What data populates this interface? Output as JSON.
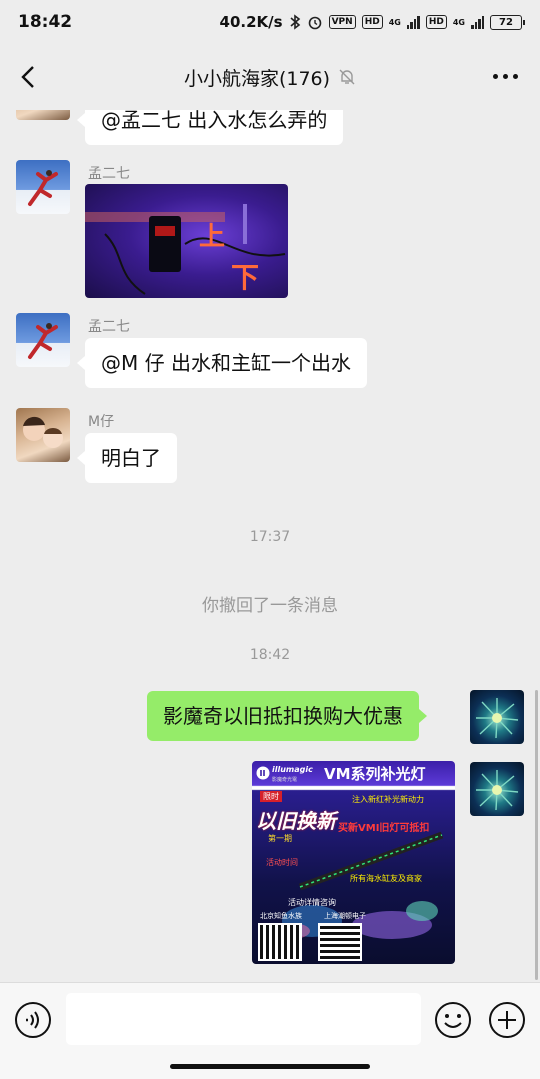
{
  "status_bar": {
    "time": "18:42",
    "net_speed": "40.2K/s",
    "vpn": "VPN",
    "hd1": "HD",
    "net1": "4G",
    "hd2": "HD",
    "net2": "4G",
    "battery": "72"
  },
  "header": {
    "title": "小小航海家(176)",
    "back_icon": "chevron-left-icon",
    "mute_icon": "bell-off-icon",
    "more_icon": "more-dots-icon"
  },
  "messages": [
    {
      "sender": "",
      "type": "text",
      "side": "left",
      "text": "@孟二七  出入水怎么弄的"
    },
    {
      "sender": "孟二七",
      "type": "image",
      "side": "left",
      "image_text_1": "上",
      "image_text_2": "下"
    },
    {
      "sender": "孟二七",
      "type": "text",
      "side": "left",
      "text": "@M 仔  出水和主缸一个出水"
    },
    {
      "sender": "M仔",
      "type": "text",
      "side": "left",
      "text": "明白了"
    },
    {
      "type": "time",
      "text": "17:37"
    },
    {
      "type": "system",
      "text": "你撤回了一条消息"
    },
    {
      "type": "time",
      "text": "18:42"
    },
    {
      "sender": "",
      "type": "text",
      "side": "right",
      "text": "影魔奇以旧抵扣换购大优惠"
    },
    {
      "sender": "",
      "type": "image",
      "side": "right",
      "poster": {
        "brand": "illumagic",
        "brand_sub": "影魔奇光電",
        "headline": "VM系列补光灯",
        "promo_big": "以旧换新",
        "promo_tag": "限时",
        "promo_line": "买新VMI旧灯可抵扣",
        "promo_sub": "第一期",
        "promo_top": "注入新红补光新动力",
        "detail1": "活动时间",
        "detail2": "所有海水缸友及商家",
        "contact": "活动详情咨询",
        "dealer1": "北京知鱼水族",
        "dealer2": "上海潮顿电子"
      }
    }
  ],
  "input_bar": {
    "placeholder": "",
    "voice_icon": "voice-icon",
    "emoji_icon": "emoji-icon",
    "plus_icon": "plus-icon"
  },
  "colors": {
    "background": "#ededed",
    "bubble_left": "#ffffff",
    "bubble_right": "#95ec69",
    "muted_text": "#999999"
  }
}
